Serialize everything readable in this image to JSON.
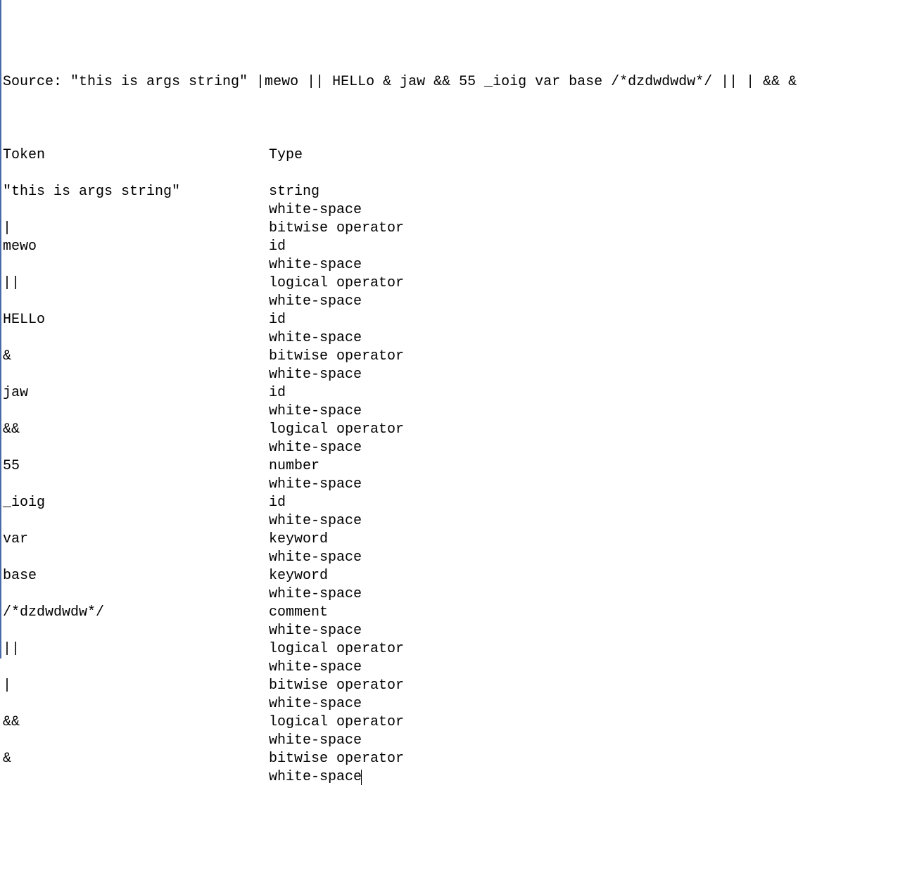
{
  "source": {
    "prefix": "Source: ",
    "text": "\"this is args string\" |mewo || HELLo & jaw && 55 _ioig var base /*dzdwdwdw*/ || | && &"
  },
  "headers": {
    "token": "Token",
    "type": "Type"
  },
  "rows": [
    {
      "token": "\"this is args string\"",
      "type": "string"
    },
    {
      "token": "",
      "type": "white-space"
    },
    {
      "token": "|",
      "type": "bitwise operator"
    },
    {
      "token": "mewo",
      "type": "id"
    },
    {
      "token": "",
      "type": "white-space"
    },
    {
      "token": "||",
      "type": "logical operator"
    },
    {
      "token": "",
      "type": "white-space"
    },
    {
      "token": "HELLo",
      "type": "id"
    },
    {
      "token": "",
      "type": "white-space"
    },
    {
      "token": "&",
      "type": "bitwise operator"
    },
    {
      "token": "",
      "type": "white-space"
    },
    {
      "token": "jaw",
      "type": "id"
    },
    {
      "token": "",
      "type": "white-space"
    },
    {
      "token": "&&",
      "type": "logical operator"
    },
    {
      "token": "",
      "type": "white-space"
    },
    {
      "token": "55",
      "type": "number"
    },
    {
      "token": "",
      "type": "white-space"
    },
    {
      "token": "_ioig",
      "type": "id"
    },
    {
      "token": "",
      "type": "white-space"
    },
    {
      "token": "var",
      "type": "keyword"
    },
    {
      "token": "",
      "type": "white-space"
    },
    {
      "token": "base",
      "type": "keyword"
    },
    {
      "token": "",
      "type": "white-space"
    },
    {
      "token": "/*dzdwdwdw*/",
      "type": "comment"
    },
    {
      "token": "",
      "type": "white-space"
    },
    {
      "token": "||",
      "type": "logical operator"
    },
    {
      "token": "",
      "type": "white-space"
    },
    {
      "token": "|",
      "type": "bitwise operator"
    },
    {
      "token": "",
      "type": "white-space"
    },
    {
      "token": "&&",
      "type": "logical operator"
    },
    {
      "token": "",
      "type": "white-space"
    },
    {
      "token": "&",
      "type": "bitwise operator"
    },
    {
      "token": "",
      "type": "white-space"
    }
  ]
}
